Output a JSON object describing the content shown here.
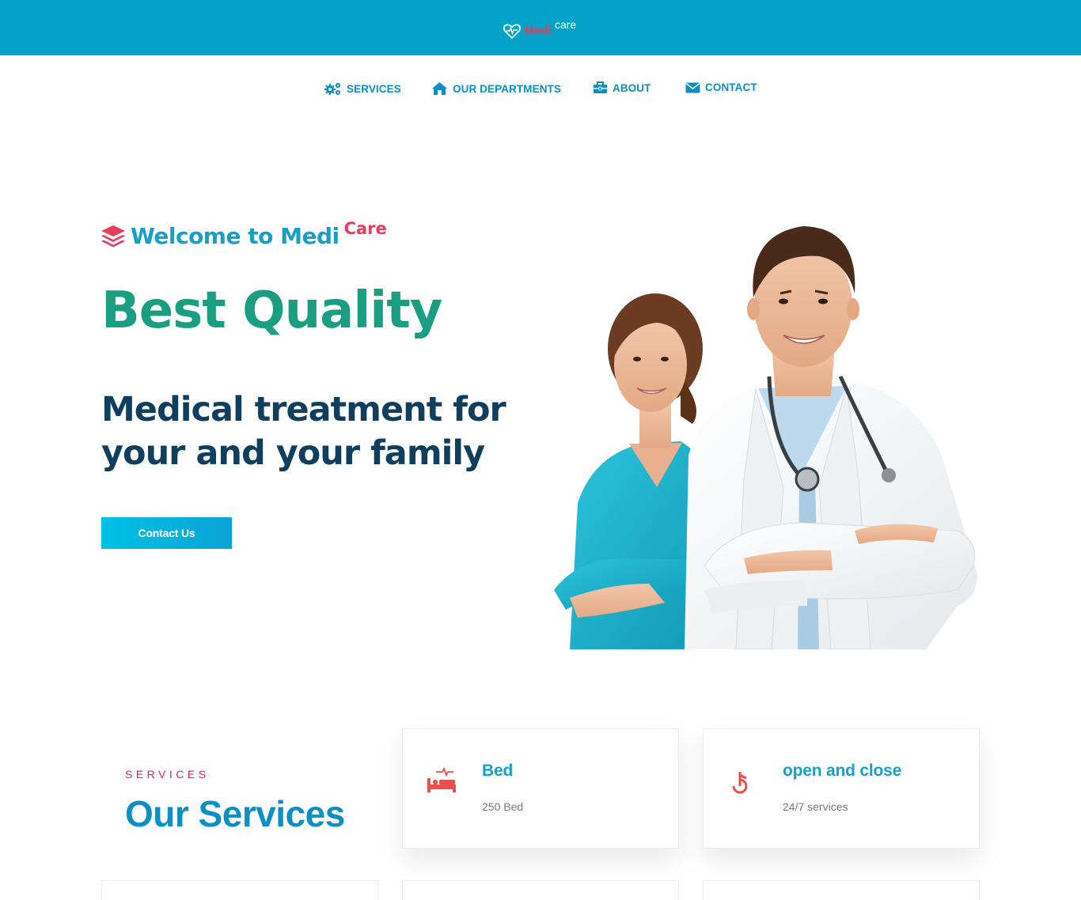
{
  "header": {
    "logo_medi": "Medi",
    "logo_care": "care"
  },
  "nav": {
    "services": "SERVICES",
    "departments": "OUR DEPARTMENTS",
    "about": "ABOUT",
    "contact": "CONTACT"
  },
  "hero": {
    "welcome": "Welcome to Medi",
    "welcome_care": "Care",
    "title": "Best Quality",
    "subtitle_line1": "Medical treatment for",
    "subtitle_line2": "your and your family",
    "cta": "Contact Us"
  },
  "services": {
    "eyebrow": "SERVICES",
    "title": "Our Services",
    "cards": [
      {
        "title": "Bed",
        "value": "250 Bed",
        "icon": "bed-icon"
      },
      {
        "title": "open and close",
        "value": "24/7 services",
        "icon": "clock-hand-icon"
      }
    ]
  },
  "colors": {
    "topbar": "#02a2c9",
    "accent_blue": "#0b8fc4",
    "accent_pink": "#e83d5c",
    "hero_green": "#1a9e82",
    "hero_navy": "#0f3f5c",
    "eyebrow_magenta": "#d41e7a"
  }
}
